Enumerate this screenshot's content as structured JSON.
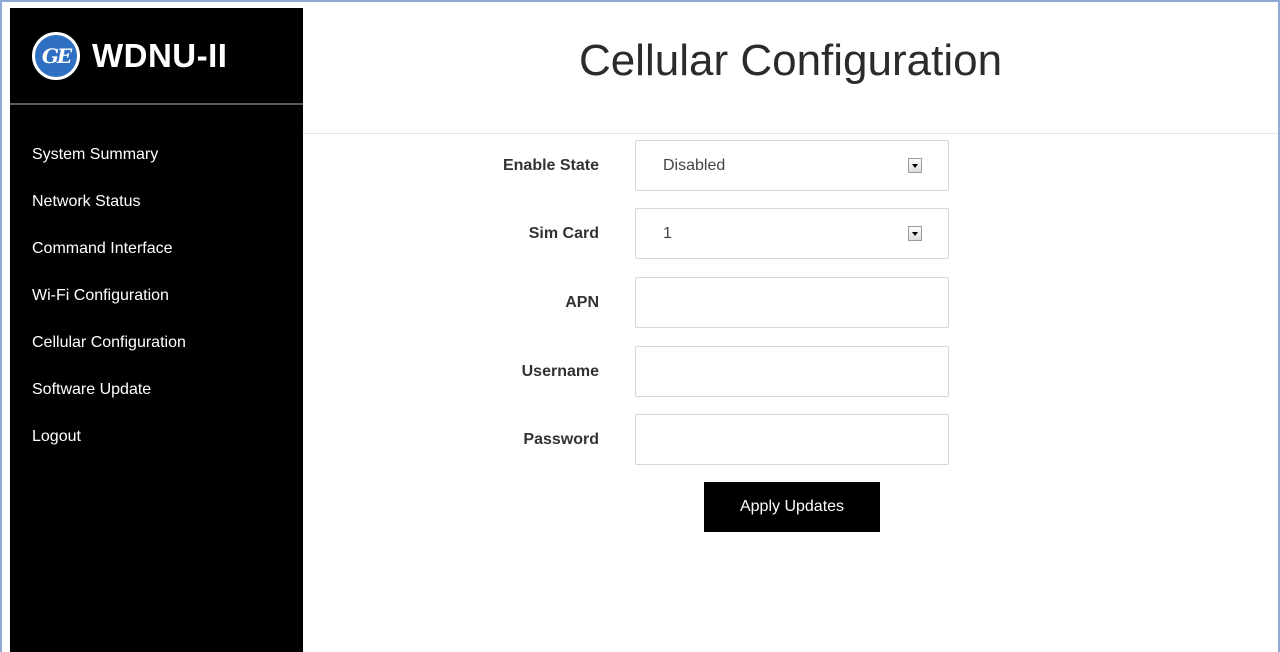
{
  "brand": {
    "title": "WDNU-II",
    "logo_text": "GE"
  },
  "sidebar": {
    "items": [
      {
        "label": "System Summary"
      },
      {
        "label": "Network Status"
      },
      {
        "label": "Command Interface"
      },
      {
        "label": "Wi-Fi Configuration"
      },
      {
        "label": "Cellular Configuration"
      },
      {
        "label": "Software Update"
      },
      {
        "label": "Logout"
      }
    ]
  },
  "page": {
    "title": "Cellular Configuration"
  },
  "form": {
    "enable_state": {
      "label": "Enable State",
      "value": "Disabled"
    },
    "sim_card": {
      "label": "Sim Card",
      "value": "1"
    },
    "apn": {
      "label": "APN",
      "value": ""
    },
    "username": {
      "label": "Username",
      "value": ""
    },
    "password": {
      "label": "Password",
      "value": ""
    },
    "apply_label": "Apply Updates"
  },
  "colors": {
    "sidebar_bg": "#000000",
    "frame": "#8fa9d6",
    "logo": "#2f6fc4",
    "button_bg": "#000000"
  }
}
